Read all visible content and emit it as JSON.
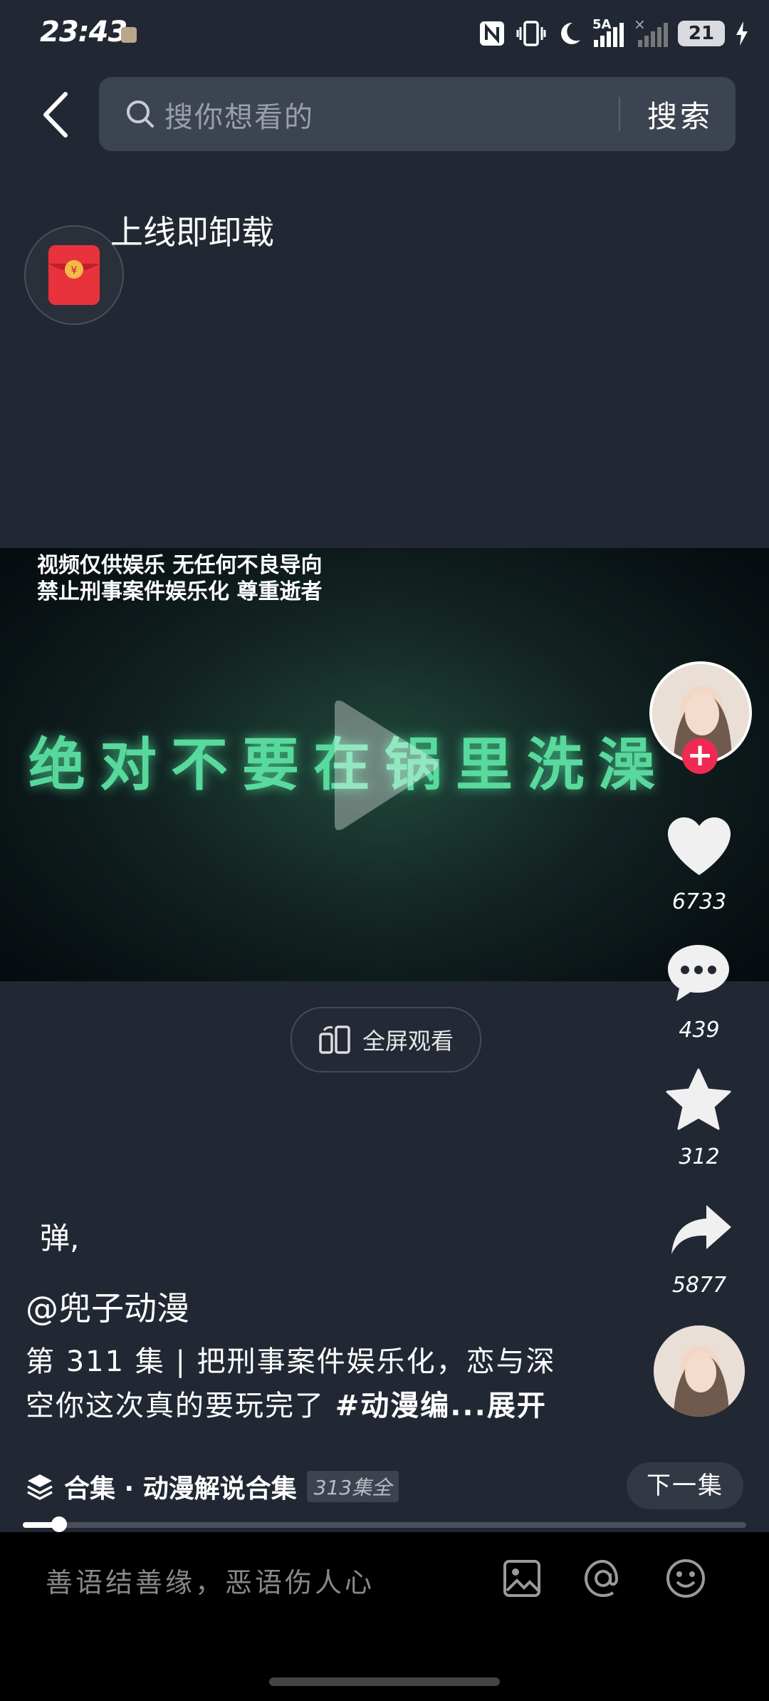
{
  "status_bar": {
    "time": "23:43",
    "network": "5A",
    "battery": "21"
  },
  "search": {
    "placeholder": "搜你想看的",
    "button": "搜索"
  },
  "promo": {
    "title": "上线即卸载"
  },
  "video": {
    "notice_line1": "视频仅供娱乐 无任何不良导向",
    "notice_line2": "禁止刑事案件娱乐化 尊重逝者",
    "overlay_text": "绝对不要在锅里洗澡",
    "fullscreen_label": "全屏观看"
  },
  "actions": {
    "likes": "6733",
    "comments": "439",
    "favorites": "312",
    "shares": "5877"
  },
  "caption": {
    "danmu": "弹",
    "author": "@兜子动漫",
    "line1": "第 311 集 | 把刑事案件娱乐化，恋与深",
    "line2_prefix": "空你这次真的要玩完了",
    "hashtag": "#动漫编...展开"
  },
  "collection": {
    "label": "合集 · 动漫解说合集",
    "episodes": "313集全",
    "next_button": "下一集",
    "progress": 0.05
  },
  "comment_bar": {
    "placeholder": "善语结善缘，恶语伤人心"
  }
}
